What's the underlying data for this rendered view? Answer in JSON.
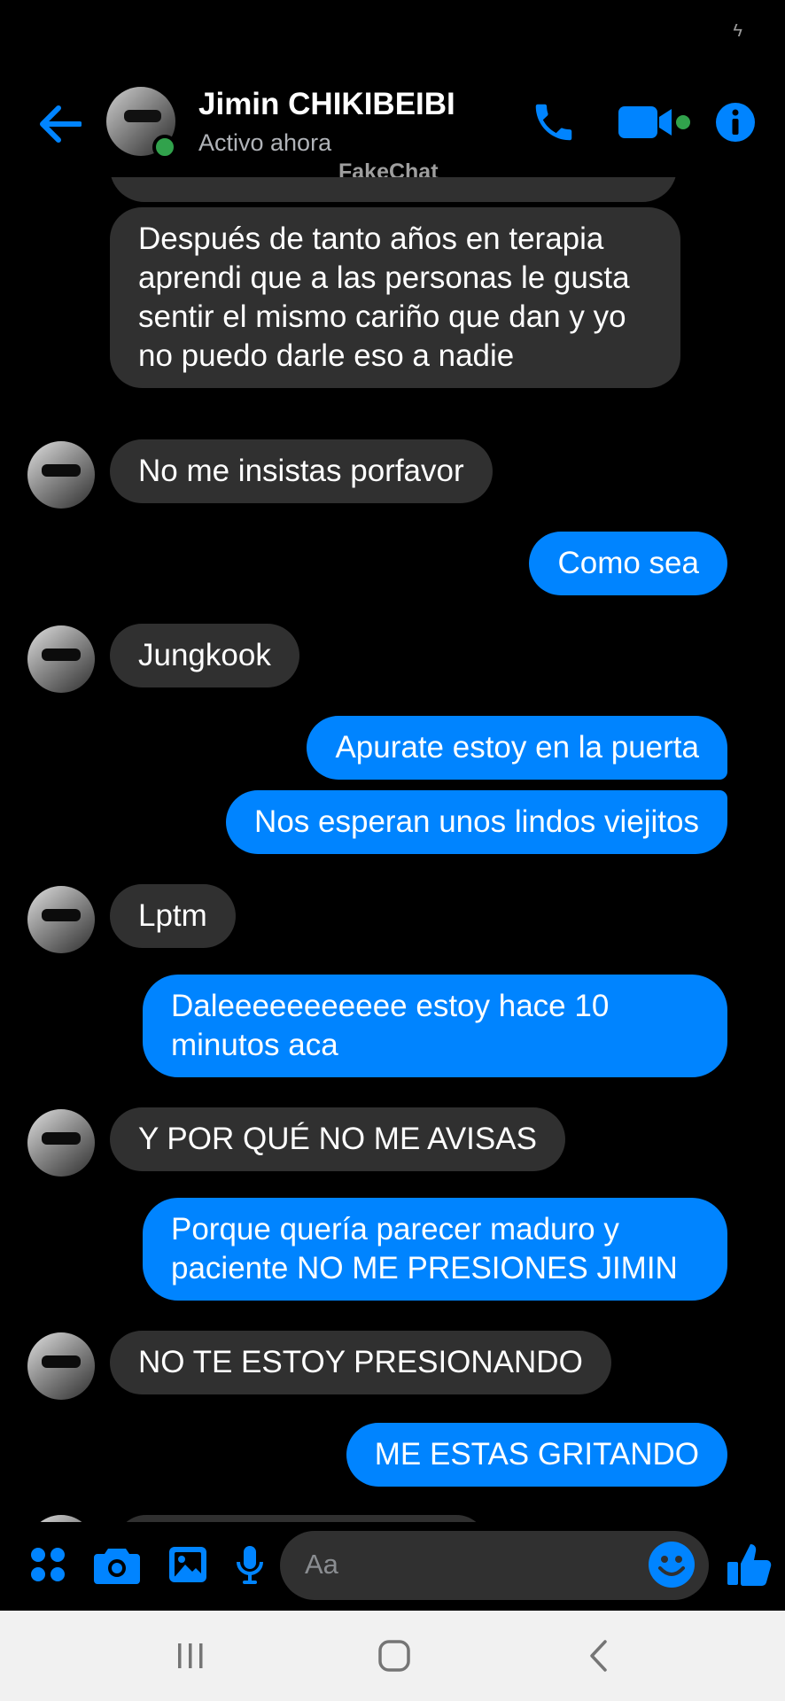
{
  "status_bar": {
    "icon": "charging-bolt-icon"
  },
  "header": {
    "contact_name": "Jimin CHIKIBEIBI",
    "status": "Activo ahora",
    "watermark": "FakeChat",
    "accent": "#0084ff",
    "online_color": "#31a24c",
    "icons": [
      "back-arrow-icon",
      "phone-icon",
      "video-camera-icon",
      "info-icon"
    ]
  },
  "messages": [
    {
      "from": "them",
      "text": "Después de tanto años en terapia aprendi que a las personas le gusta sentir el mismo cariño que dan y yo no puedo darle eso a nadie"
    },
    {
      "from": "them",
      "text": "No me insistas porfavor"
    },
    {
      "from": "me",
      "text": "Como sea"
    },
    {
      "from": "them",
      "text": "Jungkook"
    },
    {
      "from": "me",
      "text": "Apurate estoy en la puerta"
    },
    {
      "from": "me",
      "text": "Nos esperan unos lindos viejitos"
    },
    {
      "from": "them",
      "text": "Lptm"
    },
    {
      "from": "me",
      "text": "Daleeeeeeeeeee estoy hace 10 minutos aca"
    },
    {
      "from": "them",
      "text": "Y POR QUÉ NO ME AVISAS"
    },
    {
      "from": "me",
      "text": "Porque quería parecer maduro y paciente NO ME PRESIONES JIMIN"
    },
    {
      "from": "them",
      "text": "NO TE ESTOY PRESIONANDO"
    },
    {
      "from": "me",
      "text": "ME ESTAS GRITANDO"
    }
  ],
  "composer": {
    "placeholder": "Aa",
    "icons": [
      "apps-icon",
      "camera-icon",
      "gallery-icon",
      "microphone-icon",
      "emoji-icon",
      "thumbs-up-icon"
    ]
  },
  "nav_bar": {
    "icons": [
      "recent-apps-icon",
      "home-icon",
      "back-icon"
    ]
  },
  "colors": {
    "incoming_bubble": "#303030",
    "outgoing_bubble": "#0084ff",
    "background": "#000000"
  }
}
